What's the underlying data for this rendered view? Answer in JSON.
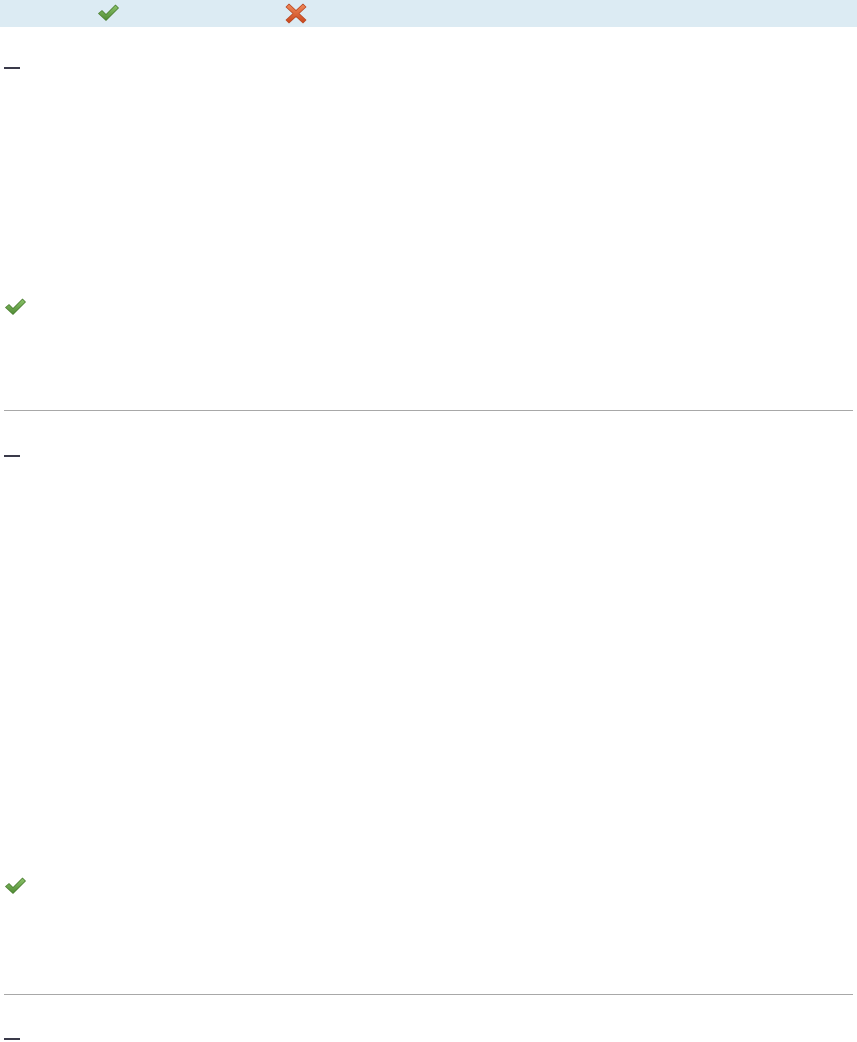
{
  "header": {
    "columns": [
      {
        "icon": "checkmark-icon",
        "color": "#6aa84f"
      },
      {
        "icon": "cross-icon",
        "color": "#e0622e"
      }
    ]
  },
  "sections": [
    {
      "toggle_icon": "collapse-dash-icon",
      "status_icon": "checkmark-icon"
    },
    {
      "toggle_icon": "collapse-dash-icon",
      "status_icon": "checkmark-icon"
    },
    {
      "toggle_icon": "collapse-dash-icon"
    }
  ],
  "colors": {
    "header_bg": "#dcebf3",
    "check_green": "#6aa84f",
    "cross_orange": "#e0622e",
    "divider": "#a8a8a8"
  }
}
